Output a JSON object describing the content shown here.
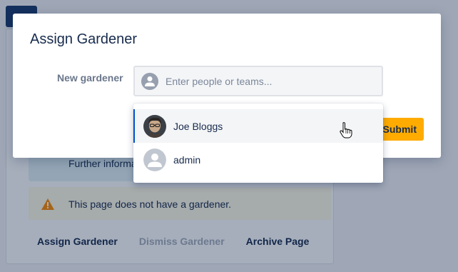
{
  "background": {
    "info_text": "Further information",
    "warning_text": "This page does not have a gardener.",
    "warning_icon": "warning-icon",
    "actions": [
      {
        "label": "Assign Gardener",
        "disabled": false
      },
      {
        "label": "Dismiss Gardener",
        "disabled": true
      },
      {
        "label": "Archive Page",
        "disabled": false
      }
    ]
  },
  "dialog": {
    "title": "Assign Gardener",
    "field_label": "New gardener",
    "picker": {
      "placeholder": "Enter people or teams...",
      "value": "",
      "icon": "user-avatar-icon"
    },
    "submit_label": "Submit"
  },
  "dropdown": {
    "options": [
      {
        "label": "Joe Bloggs",
        "avatar": "profile-photo",
        "active": true
      },
      {
        "label": "admin",
        "avatar": "default-user-icon",
        "active": false
      }
    ]
  },
  "colors": {
    "submit": "#ffab00",
    "active_indicator": "#0052cc",
    "info_bg": "#e3f3f6",
    "warning_bg": "#fffae6"
  }
}
